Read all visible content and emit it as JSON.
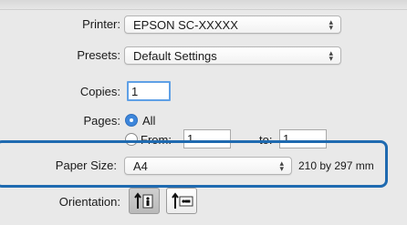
{
  "printer": {
    "label": "Printer:",
    "value": "EPSON SC-XXXXX"
  },
  "presets": {
    "label": "Presets:",
    "value": "Default Settings"
  },
  "copies": {
    "label": "Copies:",
    "value": "1"
  },
  "pages": {
    "label": "Pages:",
    "all_label": "All",
    "from_label": "From:",
    "from_value": "1",
    "to_label": "to:",
    "to_value": "1"
  },
  "paper_size": {
    "label": "Paper Size:",
    "value": "A4",
    "dimensions": "210 by 297 mm"
  },
  "orientation": {
    "label": "Orientation:",
    "selected": "portrait"
  },
  "colors": {
    "highlight": "#1f6ab0",
    "focus_ring": "#5fa0e6",
    "radio_accent": "#3d86db"
  }
}
